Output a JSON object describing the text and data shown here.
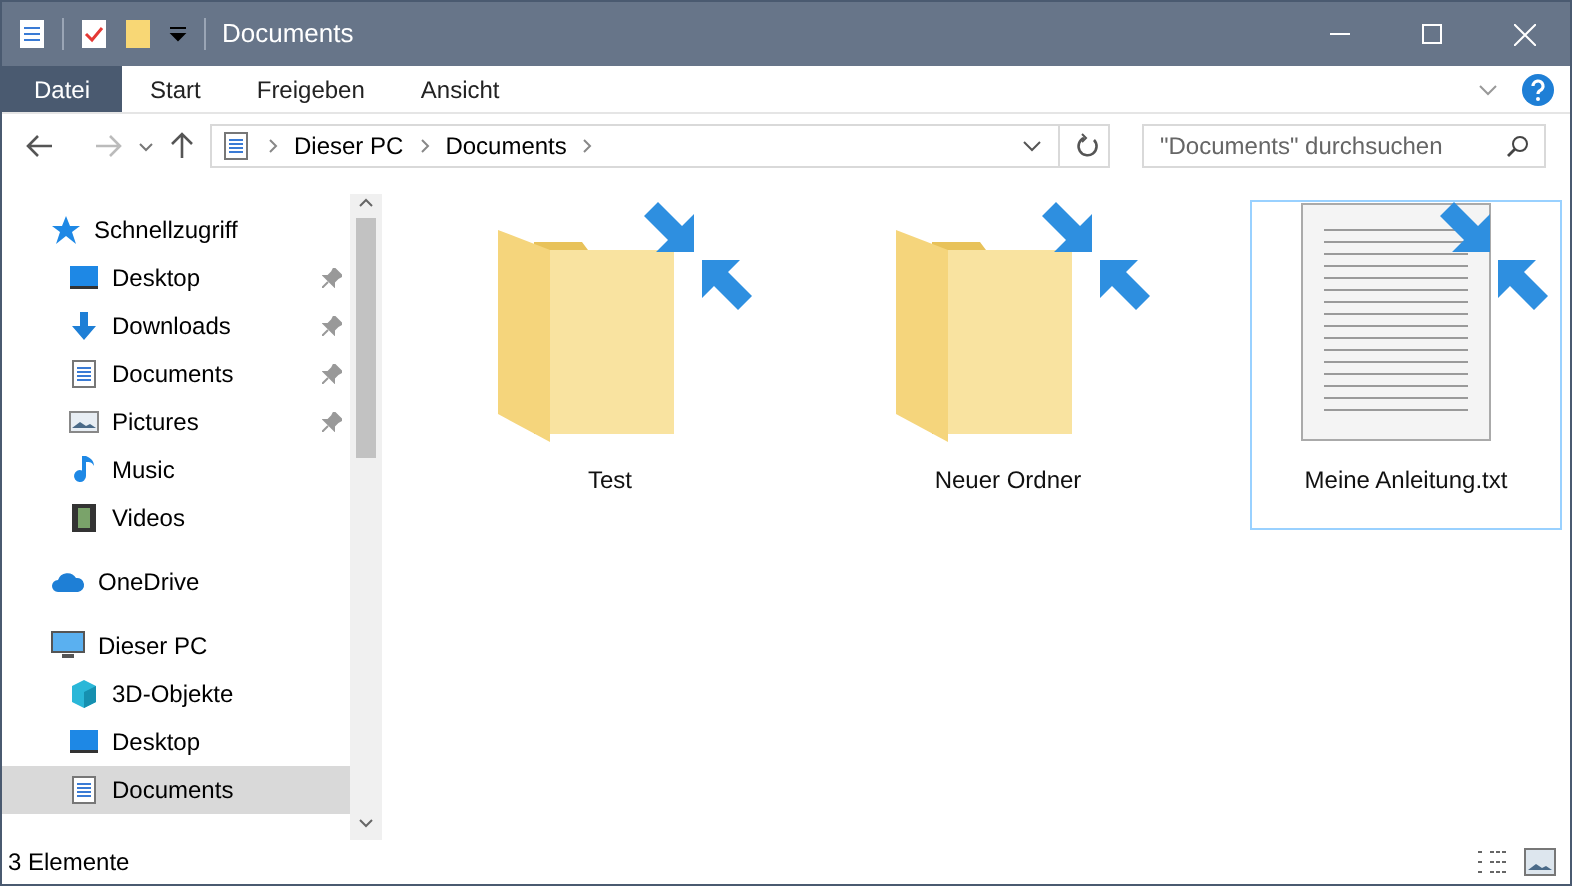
{
  "window": {
    "title": "Documents"
  },
  "ribbon_tabs": [
    {
      "label": "Datei",
      "selected": true
    },
    {
      "label": "Start",
      "selected": false
    },
    {
      "label": "Freigeben",
      "selected": false
    },
    {
      "label": "Ansicht",
      "selected": false
    }
  ],
  "address_bar": {
    "path": [
      "Dieser PC",
      "Documents"
    ]
  },
  "search": {
    "placeholder": "\"Documents\" durchsuchen"
  },
  "sidebar": {
    "items": [
      {
        "label": "Schnellzugriff",
        "selected": false,
        "children": [
          {
            "label": "Desktop",
            "pinned": true,
            "selected": false
          },
          {
            "label": "Downloads",
            "pinned": true,
            "selected": false
          },
          {
            "label": "Documents",
            "pinned": true,
            "selected": false
          },
          {
            "label": "Pictures",
            "pinned": true,
            "selected": false
          },
          {
            "label": "Music",
            "pinned": false,
            "selected": false
          },
          {
            "label": "Videos",
            "pinned": false,
            "selected": false
          }
        ]
      },
      {
        "label": "OneDrive",
        "selected": false
      },
      {
        "label": "Dieser PC",
        "selected": false,
        "children": [
          {
            "label": "3D-Objekte",
            "pinned": false,
            "selected": false
          },
          {
            "label": "Desktop",
            "pinned": false,
            "selected": false
          },
          {
            "label": "Documents",
            "pinned": false,
            "selected": true
          }
        ]
      }
    ]
  },
  "files": [
    {
      "name": "Test",
      "kind": "folder",
      "selected": false
    },
    {
      "name": "Neuer Ordner",
      "kind": "folder",
      "selected": false
    },
    {
      "name": "Meine Anleitung.txt",
      "kind": "text",
      "selected": true
    }
  ],
  "status_bar": {
    "count": "3 Elemente"
  }
}
